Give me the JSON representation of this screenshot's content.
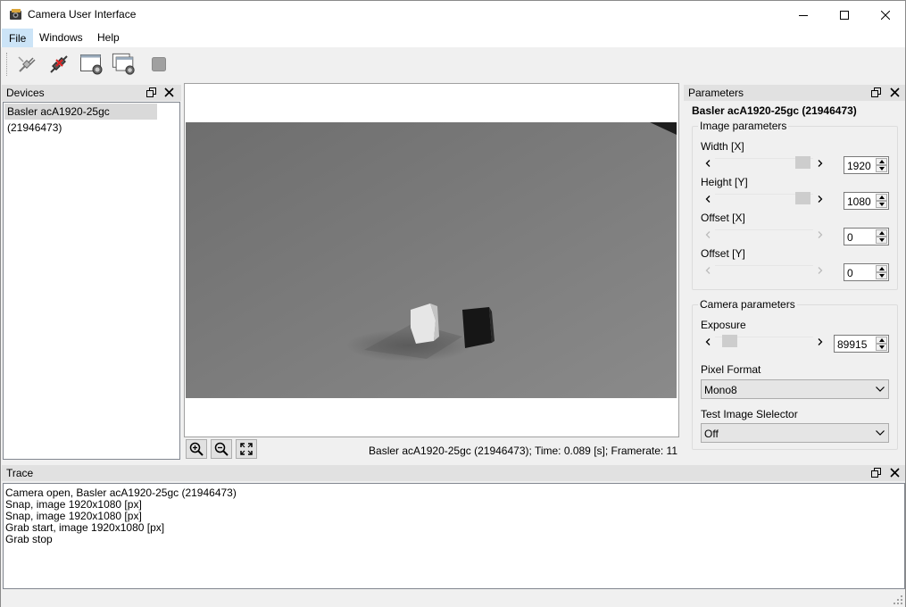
{
  "window": {
    "title": "Camera User Interface"
  },
  "menu": {
    "items": [
      "File",
      "Windows",
      "Help"
    ]
  },
  "toolbar": {
    "buttons": [
      {
        "icon": "connect-plug-icon"
      },
      {
        "icon": "disconnect-plug-icon"
      },
      {
        "icon": "single-shot-icon"
      },
      {
        "icon": "continuous-shot-icon"
      },
      {
        "icon": "stop-icon"
      }
    ]
  },
  "devices": {
    "title": "Devices",
    "items": [
      "Basler acA1920-25gc (21946473)"
    ]
  },
  "viewer": {
    "status": "Basler acA1920-25gc (21946473); Time: 0.089 [s]; Framerate: 11",
    "tools": [
      "zoom-in-icon",
      "zoom-out-icon",
      "fit-to-window-icon"
    ]
  },
  "parameters": {
    "title": "Parameters",
    "device_name": "Basler acA1920-25gc (21946473)",
    "image_group": {
      "title": "Image parameters",
      "width_label": "Width [X]",
      "width_value": "1920",
      "height_label": "Height [Y]",
      "height_value": "1080",
      "offset_x_label": "Offset [X]",
      "offset_x_value": "0",
      "offset_y_label": "Offset [Y]",
      "offset_y_value": "0"
    },
    "camera_group": {
      "title": "Camera parameters",
      "exposure_label": "Exposure",
      "exposure_value": "89915",
      "pixel_format_label": "Pixel Format",
      "pixel_format_value": "Mono8",
      "test_image_label": "Test Image Slelector",
      "test_image_value": "Off"
    }
  },
  "trace": {
    "title": "Trace",
    "lines": [
      "Camera open, Basler acA1920-25gc (21946473)",
      "Snap, image 1920x1080 [px]",
      "Snap, image 1920x1080 [px]",
      "Grab start, image 1920x1080 [px]",
      "Grab stop"
    ]
  },
  "colors": {
    "menu_active": "#cce4f7",
    "dock_title": "#e1e1e1",
    "device_selected": "#d9d9d9"
  }
}
